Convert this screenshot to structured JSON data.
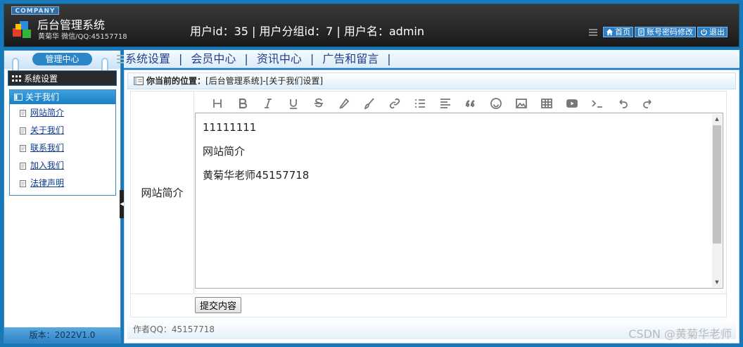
{
  "header": {
    "company": "COMPANY",
    "title": "后台管理系统",
    "subtitle": "黄菊华 微信/QQ:45157718",
    "user_info": "用户id：35 | 用户分组id：7 | 用户名：admin",
    "nav": [
      {
        "label": "首页",
        "icon": "home-icon"
      },
      {
        "label": "账号密码修改",
        "icon": "document-icon"
      },
      {
        "label": "退出",
        "icon": "power-icon"
      }
    ]
  },
  "sidebar": {
    "header": "管理中心",
    "section": "系统设置",
    "group": "关于我们",
    "items": [
      "网站简介",
      "关于我们",
      "联系我们",
      "加入我们",
      "法律声明"
    ],
    "footer": "版本：2022V1.0"
  },
  "tabs": [
    "系统设置",
    "会员中心",
    "资讯中心",
    "广告和留言"
  ],
  "breadcrumb": {
    "prefix": "你当前的位置：",
    "path": "[后台管理系统]-[关于我们设置]"
  },
  "form": {
    "label": "网站简介",
    "toolbar": [
      "heading-icon",
      "bold-icon",
      "italic-icon",
      "underline-icon",
      "strikethrough-icon",
      "highlighter-icon",
      "brush-icon",
      "link-icon",
      "bullet-list-icon",
      "align-icon",
      "quote-icon",
      "emoji-icon",
      "image-icon",
      "table-icon",
      "video-icon",
      "code-icon",
      "undo-icon",
      "redo-icon"
    ],
    "content": [
      "11111111",
      "网站简介",
      "黄菊华老师45157718"
    ],
    "submit_label": "提交内容"
  },
  "footer": "作者QQ：45157718",
  "watermark": "CSDN @黄菊华老师"
}
